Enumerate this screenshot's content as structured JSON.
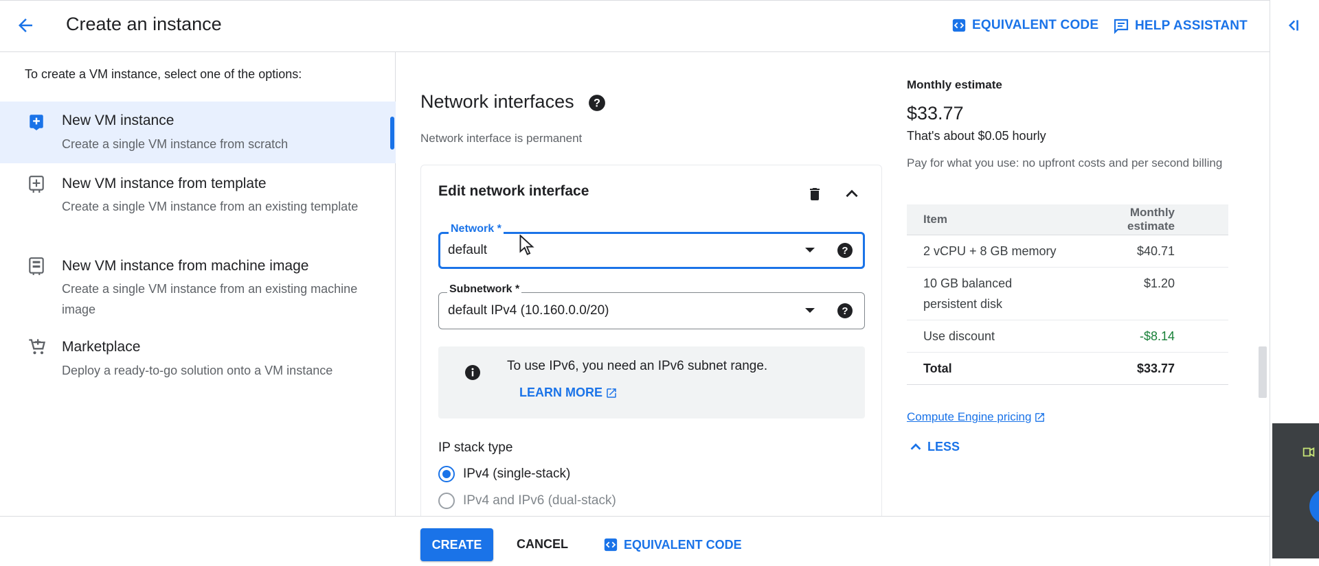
{
  "header": {
    "title": "Create an instance",
    "equivalent_code": "EQUIVALENT CODE",
    "help_assistant": "HELP ASSISTANT"
  },
  "sidebar": {
    "intro": "To create a VM instance, select one of the options:",
    "options": [
      {
        "title": "New VM instance",
        "desc": "Create a single VM instance from scratch",
        "icon": "add-box-icon",
        "selected": true
      },
      {
        "title": "New VM instance from template",
        "desc": "Create a single VM instance from an existing template",
        "icon": "add-template-icon",
        "selected": false
      },
      {
        "title": "New VM instance from machine image",
        "desc": "Create a single VM instance from an existing machine image",
        "icon": "machine-image-icon",
        "selected": false
      },
      {
        "title": "Marketplace",
        "desc": "Deploy a ready-to-go solution onto a VM instance",
        "icon": "cart-icon",
        "selected": false
      }
    ]
  },
  "main": {
    "section_title": "Network interfaces",
    "section_subtitle": "Network interface is permanent",
    "card_title": "Edit network interface",
    "network": {
      "label": "Network *",
      "value": "default"
    },
    "subnetwork": {
      "label": "Subnetwork *",
      "value": "default IPv4 (10.160.0.0/20)"
    },
    "info": {
      "text": "To use IPv6, you need an IPv6 subnet range.",
      "link": "LEARN MORE"
    },
    "ip_stack": {
      "label": "IP stack type",
      "options": [
        {
          "label": "IPv4 (single-stack)",
          "selected": true
        },
        {
          "label": "IPv4 and IPv6 (dual-stack)",
          "selected": false
        }
      ]
    }
  },
  "estimate": {
    "heading": "Monthly estimate",
    "total": "$33.77",
    "hourly": "That's about $0.05 hourly",
    "note": "Pay for what you use: no upfront costs and per second billing",
    "table": {
      "headers": [
        "Item",
        "Monthly estimate"
      ],
      "rows": [
        {
          "item": "2 vCPU + 8 GB memory",
          "cost": "$40.71"
        },
        {
          "item": "10 GB balanced persistent disk",
          "cost": "$1.20"
        },
        {
          "item": "Use discount",
          "cost": "-$8.14"
        },
        {
          "item": "Total",
          "cost": "$33.77"
        }
      ]
    },
    "pricing_link": "Compute Engine pricing",
    "less": "LESS"
  },
  "footer": {
    "create": "CREATE",
    "cancel": "CANCEL",
    "equivalent_code": "EQUIVALENT CODE"
  },
  "colors": {
    "accent": "#1a73e8",
    "selected_bg": "#e8f0fe",
    "discount": "#188038"
  }
}
